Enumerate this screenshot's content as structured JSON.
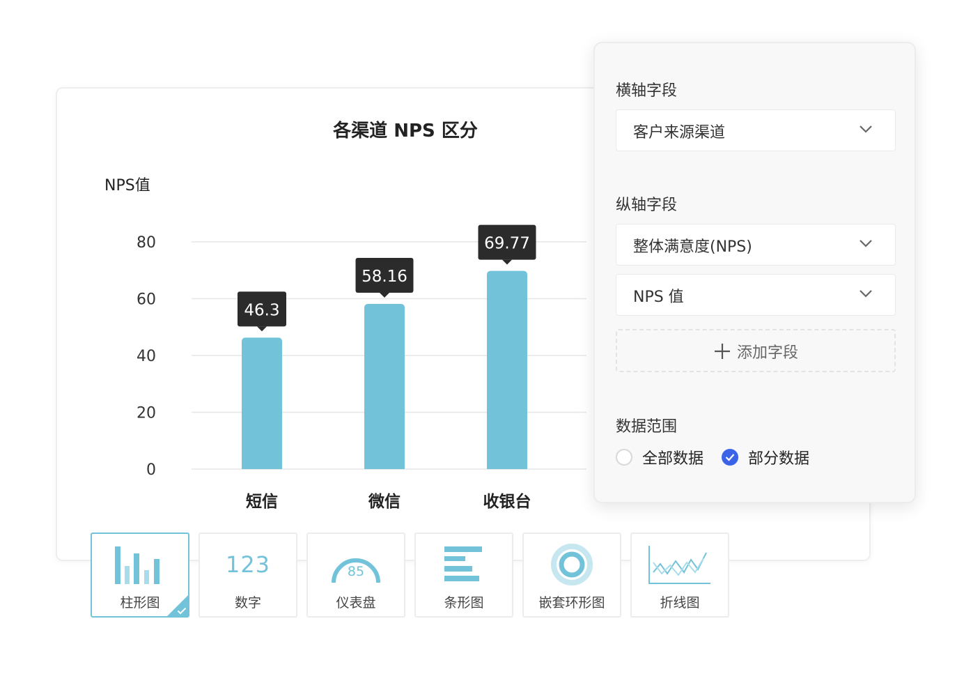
{
  "chart_card": {
    "chart_data": {
      "type": "bar",
      "title": "各渠道 NPS 区分",
      "ylabel": "NPS值",
      "xlabel": "",
      "categories": [
        "短信",
        "微信",
        "收银台"
      ],
      "values": [
        46.3,
        58.16,
        69.77
      ],
      "value_labels": [
        "46.3",
        "58.16",
        "69.77"
      ],
      "yticks": [
        "0",
        "20",
        "40",
        "60",
        "80"
      ],
      "ylim": [
        0,
        80
      ],
      "grid": true,
      "bar_color": "#72c3da",
      "label_bg": "#2b2b2b"
    }
  },
  "panel": {
    "x_axis_label": "横轴字段",
    "x_field": "客户来源渠道",
    "y_axis_label": "纵轴字段",
    "y_fields": [
      "整体满意度(NPS)",
      "NPS 值"
    ],
    "add_field": "添加字段",
    "range_label": "数据范围",
    "range_options": [
      {
        "label": "全部数据",
        "selected": false
      },
      {
        "label": "部分数据",
        "selected": true
      }
    ],
    "accent": "#3b63e8"
  },
  "chart_types": [
    {
      "label": "柱形图",
      "icon": "bar-chart-icon",
      "active": true
    },
    {
      "label": "数字",
      "icon": "number-icon",
      "icon_text": "123",
      "active": false
    },
    {
      "label": "仪表盘",
      "icon": "gauge-icon",
      "icon_text": "85",
      "active": false
    },
    {
      "label": "条形图",
      "icon": "horizontal-bar-icon",
      "active": false
    },
    {
      "label": "嵌套环形图",
      "icon": "nested-ring-icon",
      "active": false
    },
    {
      "label": "折线图",
      "icon": "line-chart-icon",
      "active": false
    }
  ]
}
